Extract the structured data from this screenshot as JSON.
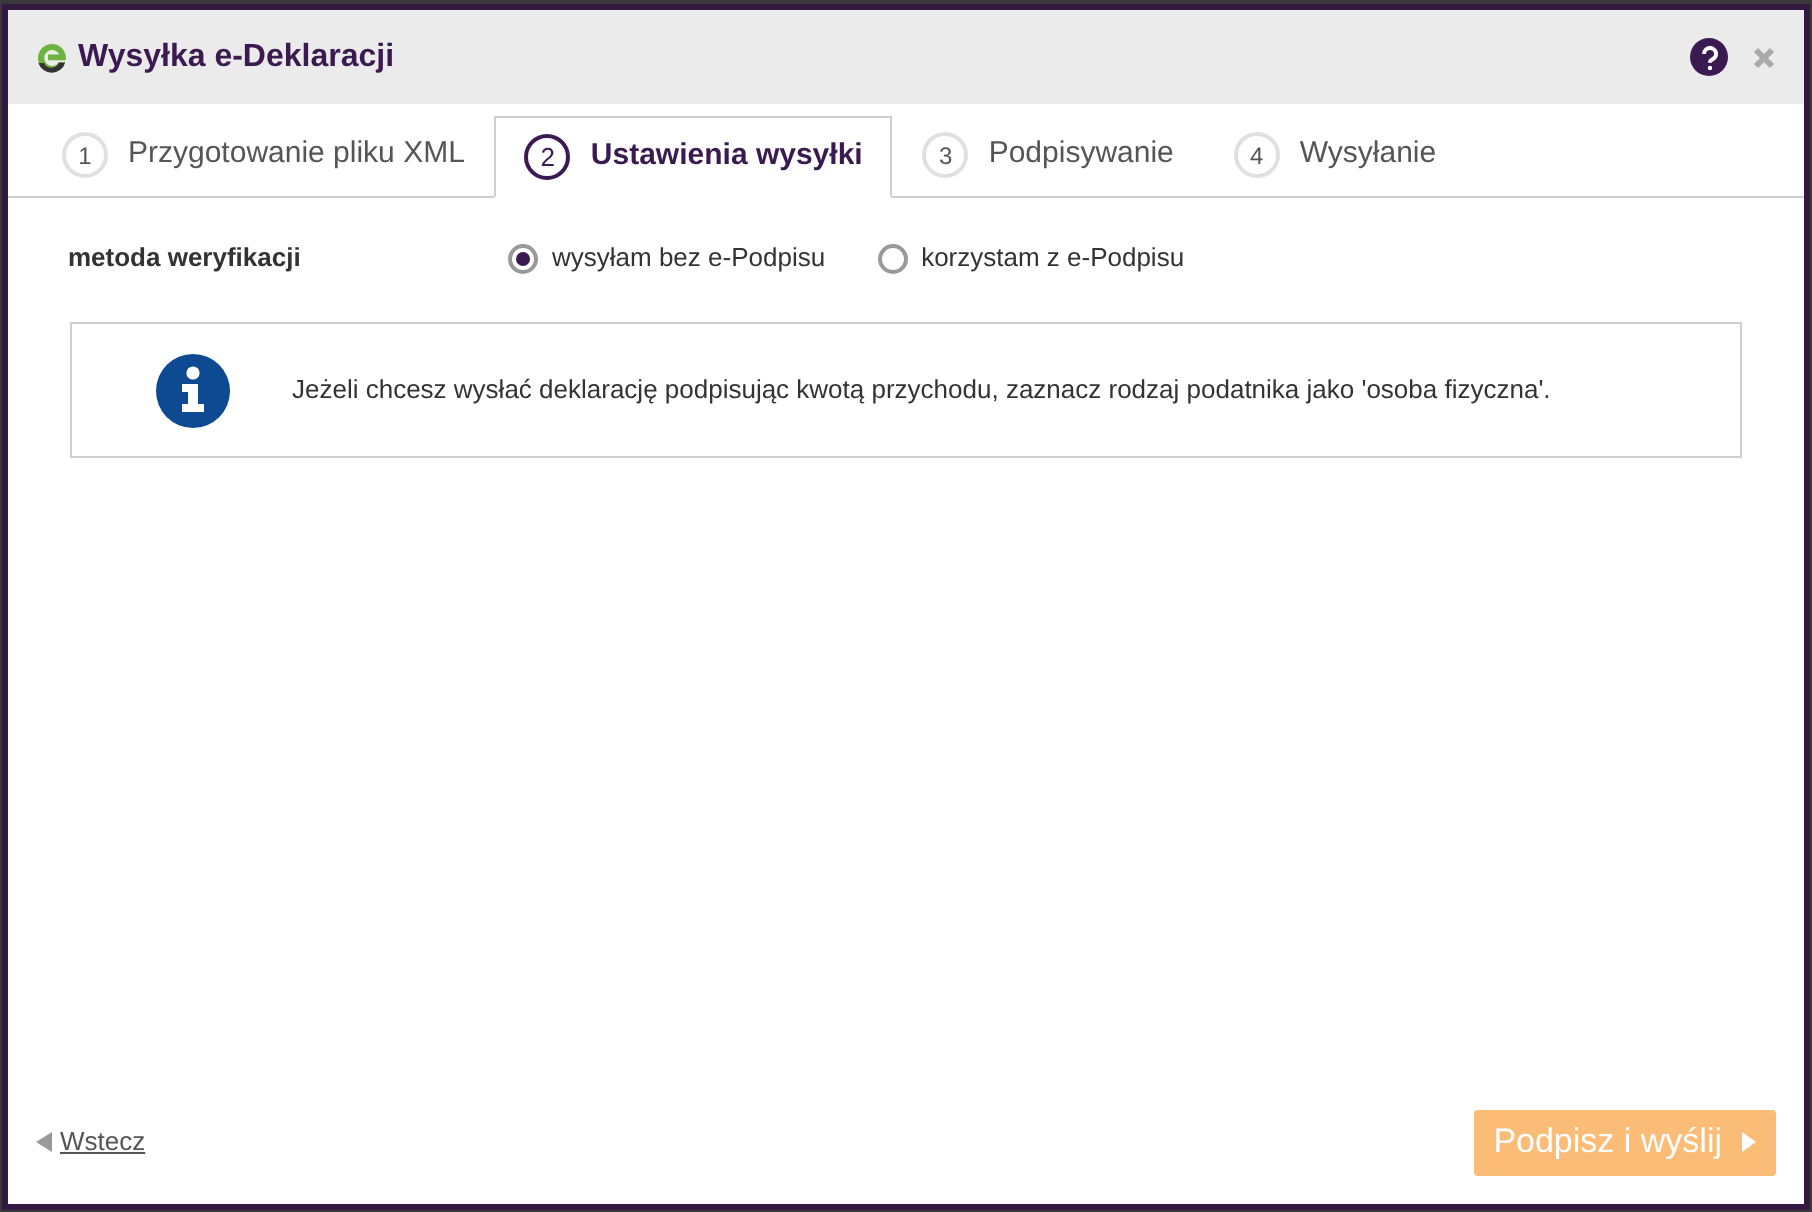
{
  "window": {
    "title": "Wysyłka e-Deklaracji"
  },
  "tabs": [
    {
      "number": "1",
      "label": "Przygotowanie pliku XML",
      "selected": false
    },
    {
      "number": "2",
      "label": "Ustawienia wysyłki",
      "selected": true
    },
    {
      "number": "3",
      "label": "Podpisywanie",
      "selected": false
    },
    {
      "number": "4",
      "label": "Wysyłanie",
      "selected": false
    }
  ],
  "verification": {
    "label": "metoda weryfikacji",
    "options": [
      {
        "label": "wysyłam bez e-Podpisu",
        "selected": true
      },
      {
        "label": "korzystam z e-Podpisu",
        "selected": false
      }
    ]
  },
  "info": {
    "text": "Jeżeli chcesz wysłać deklarację podpisując kwotą przychodu, zaznacz rodzaj podatnika jako 'osoba fizyczna'."
  },
  "footer": {
    "back_link": "Wstecz",
    "submit": {
      "label": "Podpisz i wyślij",
      "disabled": true
    }
  }
}
